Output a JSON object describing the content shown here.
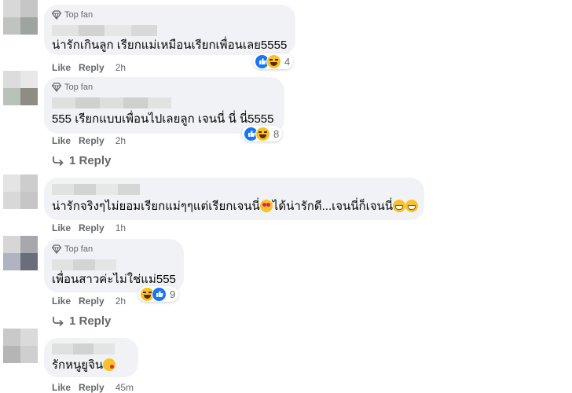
{
  "labels": {
    "top_fan": "Top fan",
    "like": "Like",
    "reply": "Reply"
  },
  "comments": [
    {
      "top_fan": true,
      "text": "น่ารักเกินลูก เรียกแม่เหมือนเรียกเพื่อนเลย5555",
      "reactions": [
        "like",
        "haha"
      ],
      "reaction_count": "4",
      "time": "2h",
      "replies": ""
    },
    {
      "top_fan": true,
      "text": "555 เรียกแบบเพื่อนไปเลยลูก เจนนี่ นี่ นี่5555",
      "reactions": [
        "like",
        "haha"
      ],
      "reaction_count": "8",
      "time": "2h",
      "replies": "1 Reply"
    },
    {
      "top_fan": false,
      "text_a": "น่ารักจริงๆไม่ยอมเรียกแม่ๆๆแต่เรียกเจนนี่",
      "text_b": "ได้น่ารักดี...เจนนี่ก็เจนนี่",
      "time": "1h",
      "replies": ""
    },
    {
      "top_fan": true,
      "text": "เพื่อนสาวค่ะไม่ใช่แม่555",
      "reactions": [
        "haha",
        "like"
      ],
      "reaction_count": "9",
      "time": "2h",
      "replies": "1 Reply"
    },
    {
      "top_fan": false,
      "text": "รักหนูยูจิน",
      "time": "45m",
      "replies": ""
    }
  ],
  "colors": {
    "bubble": "#f0f2f5",
    "meta": "#65676b",
    "like_blue": "#1877f2",
    "emoji_yellow": "#f7c224"
  }
}
